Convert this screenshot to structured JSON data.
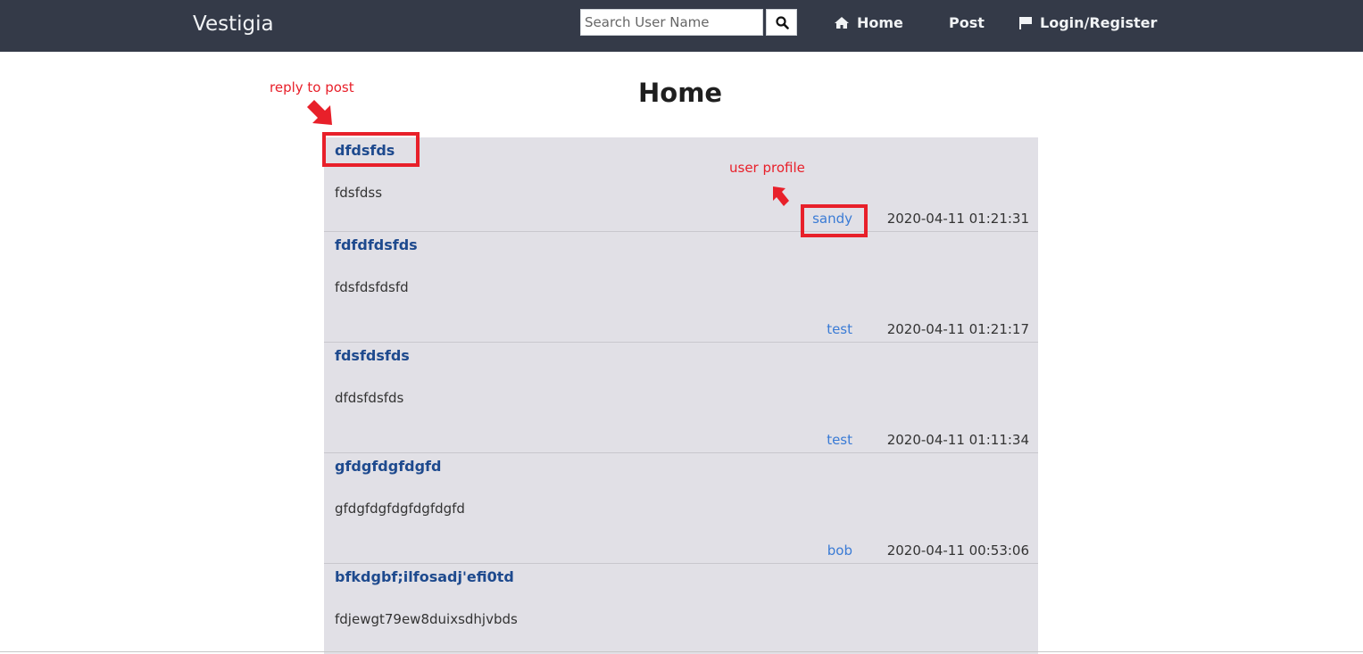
{
  "navbar": {
    "brand": "Vestigia",
    "search_placeholder": "Search User Name",
    "home_label": "Home",
    "post_label": "Post",
    "login_label": "Login/Register"
  },
  "page": {
    "title": "Home"
  },
  "posts": [
    {
      "title": "dfdsfds",
      "body": "fdsfdss",
      "user": "sandy",
      "timestamp": "2020-04-11 01:21:31"
    },
    {
      "title": "fdfdfdsfds",
      "body": "fdsfdsfdsfd",
      "user": "test",
      "timestamp": "2020-04-11 01:21:17"
    },
    {
      "title": "fdsfdsfds",
      "body": "dfdsfdsfds",
      "user": "test",
      "timestamp": "2020-04-11 01:11:34"
    },
    {
      "title": "gfdgfdgfdgfd",
      "body": "gfdgfdgfdgfdgfdgfd",
      "user": "bob",
      "timestamp": "2020-04-11 00:53:06"
    },
    {
      "title": "bfkdgbf;ilfosadj'efi0td",
      "body": "fdjewgt79ew8duixsdhjvbds",
      "user": "",
      "timestamp": ""
    }
  ],
  "annotations": {
    "reply_label": "reply to post",
    "profile_label": "user profile",
    "color": "#e8202a"
  },
  "icons": {
    "search": "search-icon",
    "home": "home-icon",
    "login": "flag-icon"
  }
}
